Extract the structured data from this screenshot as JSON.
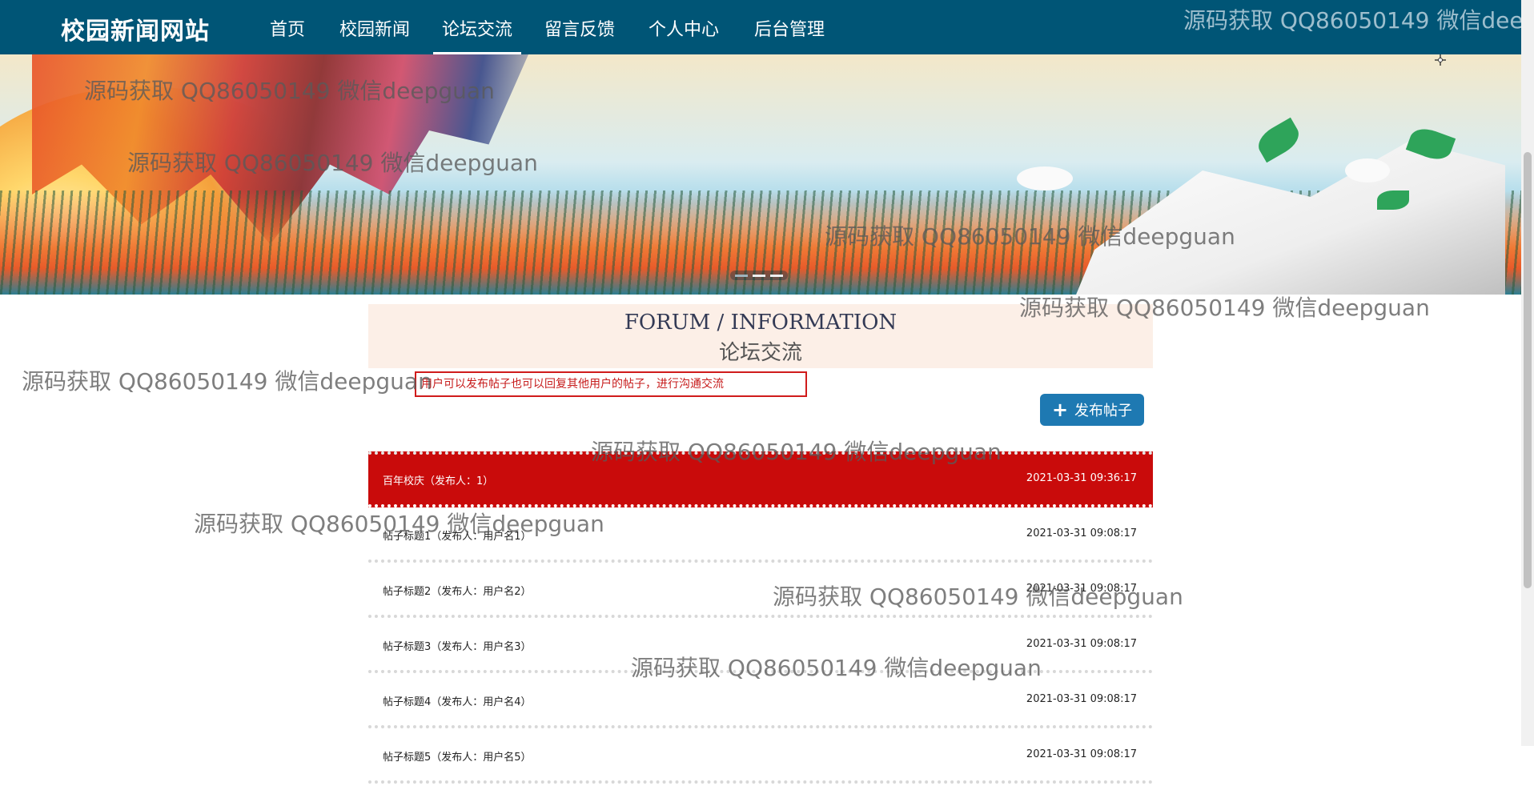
{
  "navbar": {
    "brand": "校园新闻网站",
    "items": [
      {
        "label": "首页",
        "active": false
      },
      {
        "label": "校园新闻",
        "active": false
      },
      {
        "label": "论坛交流",
        "active": true
      },
      {
        "label": "留言反馈",
        "active": false
      },
      {
        "label": "个人中心",
        "active": false
      },
      {
        "label": "后台管理",
        "active": false
      }
    ]
  },
  "forum": {
    "title_en": "FORUM / INFORMATION",
    "title_cn": "论坛交流",
    "hint": "用户可以发布帖子也可以回复其他用户的帖子，进行沟通交流",
    "post_button_label": "发布帖子",
    "posts": [
      {
        "title": "百年校庆（发布人：1）",
        "date": "2021-03-31 09:36:17"
      },
      {
        "title": "帖子标题1（发布人：用户名1）",
        "date": "2021-03-31 09:08:17"
      },
      {
        "title": "帖子标题2（发布人：用户名2）",
        "date": "2021-03-31 09:08:17"
      },
      {
        "title": "帖子标题3（发布人：用户名3）",
        "date": "2021-03-31 09:08:17"
      },
      {
        "title": "帖子标题4（发布人：用户名4）",
        "date": "2021-03-31 09:08:17"
      },
      {
        "title": "帖子标题5（发布人：用户名5）",
        "date": "2021-03-31 09:08:17"
      }
    ]
  },
  "watermark_text": "源码获取 QQ86050149 微信deepguan",
  "colors": {
    "navbar_bg": "#005576",
    "highlight_row": "#c90b0b",
    "post_button": "#1e79b2",
    "header_bg": "#fcefe7",
    "hint_border": "#d01b1b"
  }
}
